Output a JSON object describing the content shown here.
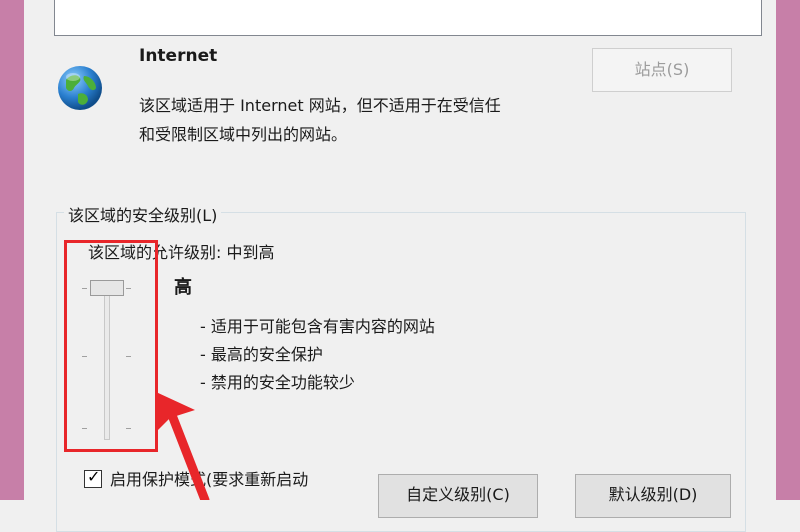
{
  "zone": {
    "title": "Internet",
    "description_line1": "该区域适用于 Internet 网站，但不适用于在受信任",
    "description_line2": "和受限制区域中列出的网站。",
    "sites_button": "站点(S)"
  },
  "security": {
    "group_label": "该区域的安全级别(L)",
    "allowed_levels": "该区域的允许级别: 中到高",
    "level_name": "高",
    "level_bullets": [
      "适用于可能包含有害内容的网站",
      "最高的安全保护",
      "禁用的安全功能较少"
    ],
    "slider_level": "高"
  },
  "protected_mode": {
    "checked": true,
    "label": "启用保护模式(要求重新启动"
  },
  "buttons": {
    "custom_level": "自定义级别(C)",
    "default_level": "默认级别(D)"
  },
  "colors": {
    "annotation": "#e8262a",
    "window_frame": "#c77fa8"
  }
}
